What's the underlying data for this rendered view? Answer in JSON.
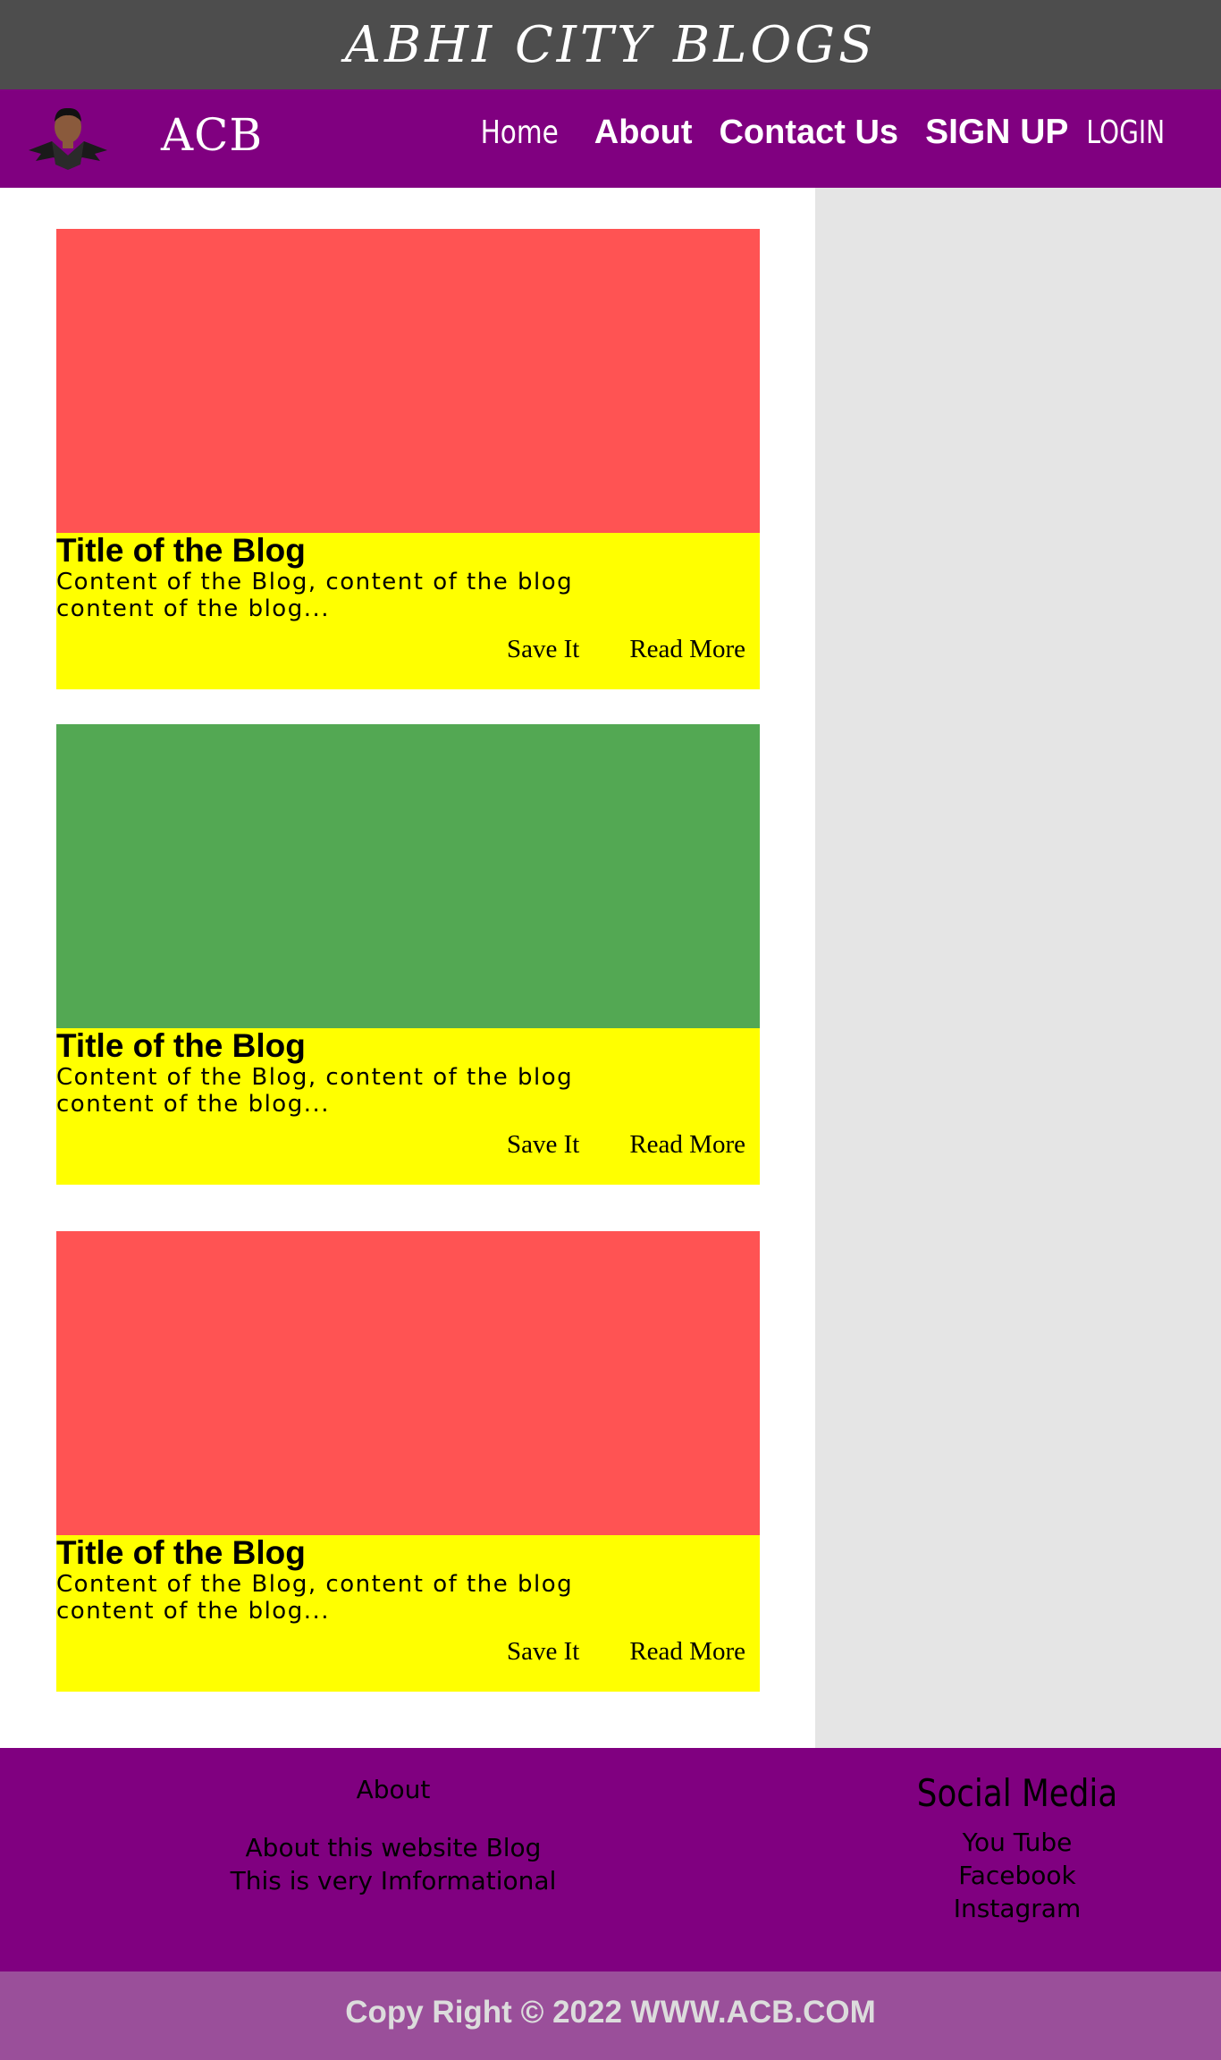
{
  "header": {
    "site_title": "ABHI CITY BLOGS"
  },
  "nav": {
    "brand": "ACB",
    "links": [
      "Home",
      "About",
      "Contact Us",
      "SIGN UP",
      "LOGIN"
    ]
  },
  "colors": {
    "header_bg": "#4d4d4d",
    "nav_bg": "#800080",
    "card_body_bg": "#ffff00",
    "sidebar_bg": "#e5e5e5",
    "copyright_bg": "#9a4f9a"
  },
  "posts": [
    {
      "image_color": "#ff5353",
      "title": "Title of the Blog",
      "excerpt": "Content of the Blog, content of the blog content of the blog...",
      "save_label": "Save It",
      "read_more_label": "Read More"
    },
    {
      "image_color": "#53a853",
      "title": "Title of the Blog",
      "excerpt": "Content of the Blog, content of the blog content of the blog...",
      "save_label": "Save It",
      "read_more_label": "Read More"
    },
    {
      "image_color": "#ff5353",
      "title": "Title of the Blog",
      "excerpt": "Content of the Blog, content of the blog content of the blog...",
      "save_label": "Save It",
      "read_more_label": "Read More"
    }
  ],
  "footer": {
    "about_heading": "About",
    "about_lines": [
      "About this website Blog",
      "This is very Imformational"
    ],
    "social_heading": "Social Media",
    "social_links": [
      "You Tube",
      "Facebook",
      "Instagram"
    ]
  },
  "copyright": "Copy Right © 2022 WWW.ACB.COM"
}
